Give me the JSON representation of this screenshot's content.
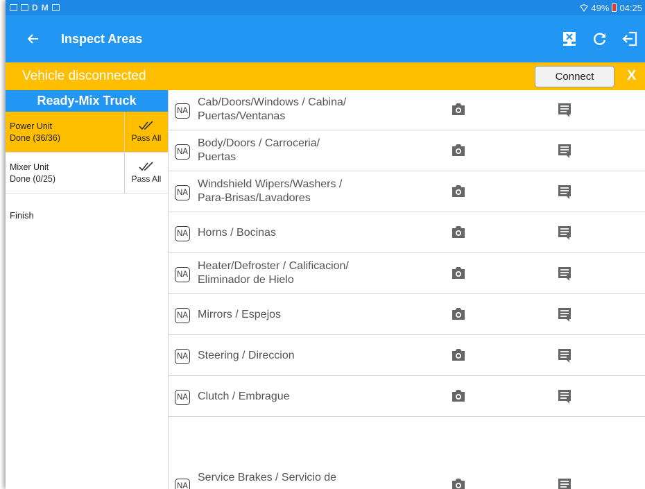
{
  "status_bar": {
    "notification_letters": [
      "D",
      "M"
    ],
    "battery": "49%",
    "time": "04:25"
  },
  "app_bar": {
    "title": "Inspect Areas",
    "icons": [
      "back-arrow-icon",
      "unlink-device-icon",
      "refresh-icon",
      "logout-icon"
    ]
  },
  "banner": {
    "message": "Vehicle disconnected",
    "connect_label": "Connect",
    "close_label": "X"
  },
  "sidebar": {
    "header": "Ready-Mix Truck",
    "units": [
      {
        "name": "Power Unit",
        "status": "Done (36/36)",
        "pass_all": "Pass All",
        "active": true
      },
      {
        "name": "Mixer Unit",
        "status": "Done (0/25)",
        "pass_all": "Pass All",
        "active": false
      }
    ],
    "finish_label": "Finish"
  },
  "inspect_items": [
    {
      "na": "NA",
      "line1": "Cab/Doors/Windows / Cabina/",
      "line2": "Puertas/Ventanas"
    },
    {
      "na": "NA",
      "line1": "Body/Doors / Carroceria/",
      "line2": "Puertas"
    },
    {
      "na": "NA",
      "line1": "Windshield Wipers/Washers /",
      "line2": "Para-Brisas/Lavadores"
    },
    {
      "na": "NA",
      "line1": "Horns / Bocinas",
      "line2": ""
    },
    {
      "na": "NA",
      "line1": "Heater/Defroster / Calificacion/",
      "line2": "Eliminador de Hielo"
    },
    {
      "na": "NA",
      "line1": "Mirrors / Espejos",
      "line2": ""
    },
    {
      "na": "NA",
      "line1": "Steering / Direccion",
      "line2": ""
    },
    {
      "na": "NA",
      "line1": "Clutch / Embrague",
      "line2": ""
    },
    {
      "na": "NA",
      "line1": "Service Brakes / Servicio de",
      "line2": ""
    }
  ],
  "colors": {
    "primary": "#2196f3",
    "status_bar": "#1e88e5",
    "warning": "#ffbf00"
  }
}
